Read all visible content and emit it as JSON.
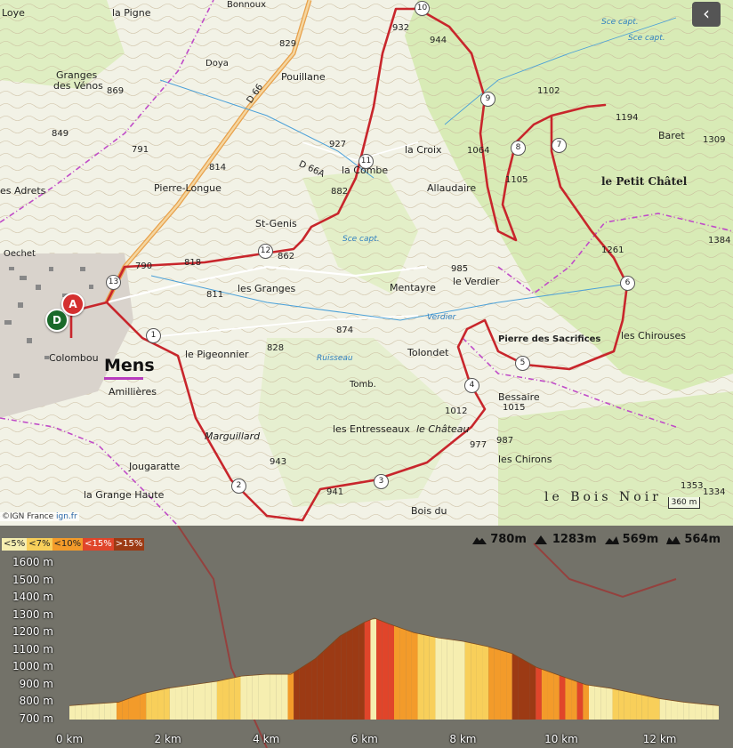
{
  "map": {
    "back_button_icon": "chevron-left-icon",
    "attribution_prefix": "©IGN France",
    "attribution_link": "ign.fr",
    "scale_label": "360 m",
    "start_marker": "A",
    "end_marker": "D",
    "town_name": "Mens",
    "places": [
      {
        "text": "Loye",
        "cls": "md"
      },
      {
        "text": "la Pigne",
        "cls": "md"
      },
      {
        "text": "Bonnoux",
        "cls": "sm"
      },
      {
        "text": "Granges",
        "cls": "md"
      },
      {
        "text": "des Vénos",
        "cls": "md"
      },
      {
        "text": "Doya",
        "cls": "sm"
      },
      {
        "text": "Pouillane",
        "cls": "md"
      },
      {
        "text": "la Croix",
        "cls": "md"
      },
      {
        "text": "la Combe",
        "cls": "md"
      },
      {
        "text": "Allaudaire",
        "cls": "md"
      },
      {
        "text": "Baret",
        "cls": "md"
      },
      {
        "text": "le Petit Châtel",
        "cls": "bold"
      },
      {
        "text": "es Adrets",
        "cls": "md"
      },
      {
        "text": "Pierre-Longue",
        "cls": "md"
      },
      {
        "text": "St-Genis",
        "cls": "md"
      },
      {
        "text": "Oechet",
        "cls": "sm"
      },
      {
        "text": "les Granges",
        "cls": "md"
      },
      {
        "text": "Mentayre",
        "cls": "md"
      },
      {
        "text": "le Verdier",
        "cls": "md"
      },
      {
        "text": "Pierre des Sacrifices",
        "cls": "sm"
      },
      {
        "text": "les Chirouses",
        "cls": "md"
      },
      {
        "text": "le Pigeonnier",
        "cls": "md"
      },
      {
        "text": "Tolondet",
        "cls": "md"
      },
      {
        "text": "Colombou",
        "cls": "md"
      },
      {
        "text": "Amillières",
        "cls": "md"
      },
      {
        "text": "Tomb.",
        "cls": "sm"
      },
      {
        "text": "Bessaire",
        "cls": "md"
      },
      {
        "text": "Marguillard",
        "cls": "italic"
      },
      {
        "text": "les Entresseaux",
        "cls": "md"
      },
      {
        "text": "le Château",
        "cls": "italic"
      },
      {
        "text": "les Chirons",
        "cls": "md"
      },
      {
        "text": "Jougaratte",
        "cls": "md"
      },
      {
        "text": "la Grange Haute",
        "cls": "md"
      },
      {
        "text": "le Bois Noir",
        "cls": "lg"
      },
      {
        "text": "Bois du",
        "cls": "md"
      },
      {
        "text": "D 66",
        "cls": "sm"
      },
      {
        "text": "D 66A",
        "cls": "sm"
      },
      {
        "text": "Sce capt.",
        "cls": "blue"
      },
      {
        "text": "Sce capt.",
        "cls": "blue"
      },
      {
        "text": "Sce capt.",
        "cls": "blue"
      },
      {
        "text": "Ruisseau",
        "cls": "blue"
      },
      {
        "text": "Verdier",
        "cls": "blue"
      }
    ],
    "spot_heights": [
      "869",
      "849",
      "829",
      "791",
      "814",
      "927",
      "862",
      "882",
      "1064",
      "1102",
      "1194",
      "1309",
      "1384",
      "1105",
      "1261",
      "985",
      "874",
      "828",
      "811",
      "790",
      "818",
      "943",
      "1012",
      "977",
      "1015",
      "987",
      "941",
      "1334",
      "1353",
      "932",
      "944"
    ],
    "waypoints": [
      "1",
      "2",
      "3",
      "4",
      "5",
      "6",
      "7",
      "8",
      "9",
      "10",
      "11",
      "12",
      "13"
    ]
  },
  "profile": {
    "grade_legend": [
      "<5%",
      "<7%",
      "<10%",
      "<15%",
      ">15%"
    ],
    "grade_colors": [
      "#f6eeb0",
      "#f8cf5a",
      "#f39b2a",
      "#e0452a",
      "#9c3a14"
    ],
    "stats": [
      {
        "icon": "elevation-min-icon",
        "value": "780m"
      },
      {
        "icon": "elevation-max-icon",
        "value": "1283m"
      },
      {
        "icon": "ascent-icon",
        "value": "569m"
      },
      {
        "icon": "descent-icon",
        "value": "564m"
      }
    ],
    "y_ticks": [
      "1600 m",
      "1500 m",
      "1400 m",
      "1300 m",
      "1200 m",
      "1100 m",
      "1000 m",
      "900 m",
      "800 m",
      "700 m"
    ],
    "x_ticks": [
      "0 km",
      "2 km",
      "4 km",
      "6 km",
      "8 km",
      "10 km",
      "12 km"
    ]
  },
  "chart_data": {
    "type": "area",
    "xlabel": "",
    "ylabel": "",
    "xlim": [
      0,
      13.2
    ],
    "ylim": [
      700,
      1600
    ],
    "x": [
      0,
      0.5,
      1.0,
      1.5,
      2.0,
      2.5,
      3.0,
      3.5,
      4.0,
      4.5,
      5.0,
      5.5,
      6.0,
      6.2,
      6.5,
      7.0,
      7.5,
      8.0,
      8.5,
      9.0,
      9.5,
      10.0,
      10.5,
      11.0,
      11.5,
      12.0,
      12.5,
      13.0,
      13.2
    ],
    "y": [
      780,
      790,
      800,
      850,
      880,
      900,
      920,
      950,
      960,
      960,
      1050,
      1180,
      1260,
      1283,
      1250,
      1200,
      1170,
      1150,
      1120,
      1080,
      1000,
      950,
      900,
      880,
      850,
      820,
      800,
      785,
      780
    ]
  }
}
